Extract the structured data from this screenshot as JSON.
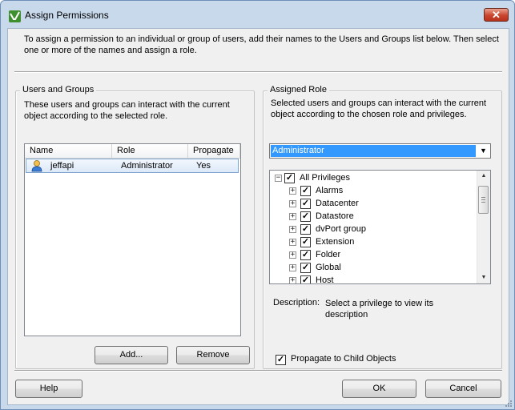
{
  "window": {
    "title": "Assign Permissions",
    "close_label": "✕"
  },
  "intro": "To assign a permission to an individual or group of users, add their names to the Users and Groups list below. Then select one or more of the names and assign a role.",
  "users_groups": {
    "legend": "Users and Groups",
    "description": "These users and groups can interact with the current object according to the selected role.",
    "columns": [
      "Name",
      "Role",
      "Propagate"
    ],
    "rows": [
      {
        "name": "jeffapi",
        "role": "Administrator",
        "propagate": "Yes",
        "icon": "user-icon"
      }
    ],
    "add_label": "Add...",
    "remove_label": "Remove"
  },
  "assigned_role": {
    "legend": "Assigned Role",
    "description": "Selected users and groups can interact with the current object according to the chosen role and privileges.",
    "role_selected": "Administrator",
    "tree_root": "All Privileges",
    "privileges": [
      "Alarms",
      "Datacenter",
      "Datastore",
      "dvPort group",
      "Extension",
      "Folder",
      "Global",
      "Host"
    ],
    "description_label": "Description:",
    "description_text": "Select a privilege to view its description",
    "propagate_label": "Propagate to Child Objects",
    "propagate_checked": true
  },
  "footer": {
    "help_label": "Help",
    "ok_label": "OK",
    "cancel_label": "Cancel"
  },
  "colors": {
    "selection": "#3399ff",
    "titlebar": "#c9d9ec",
    "close_button": "#c9452c"
  }
}
